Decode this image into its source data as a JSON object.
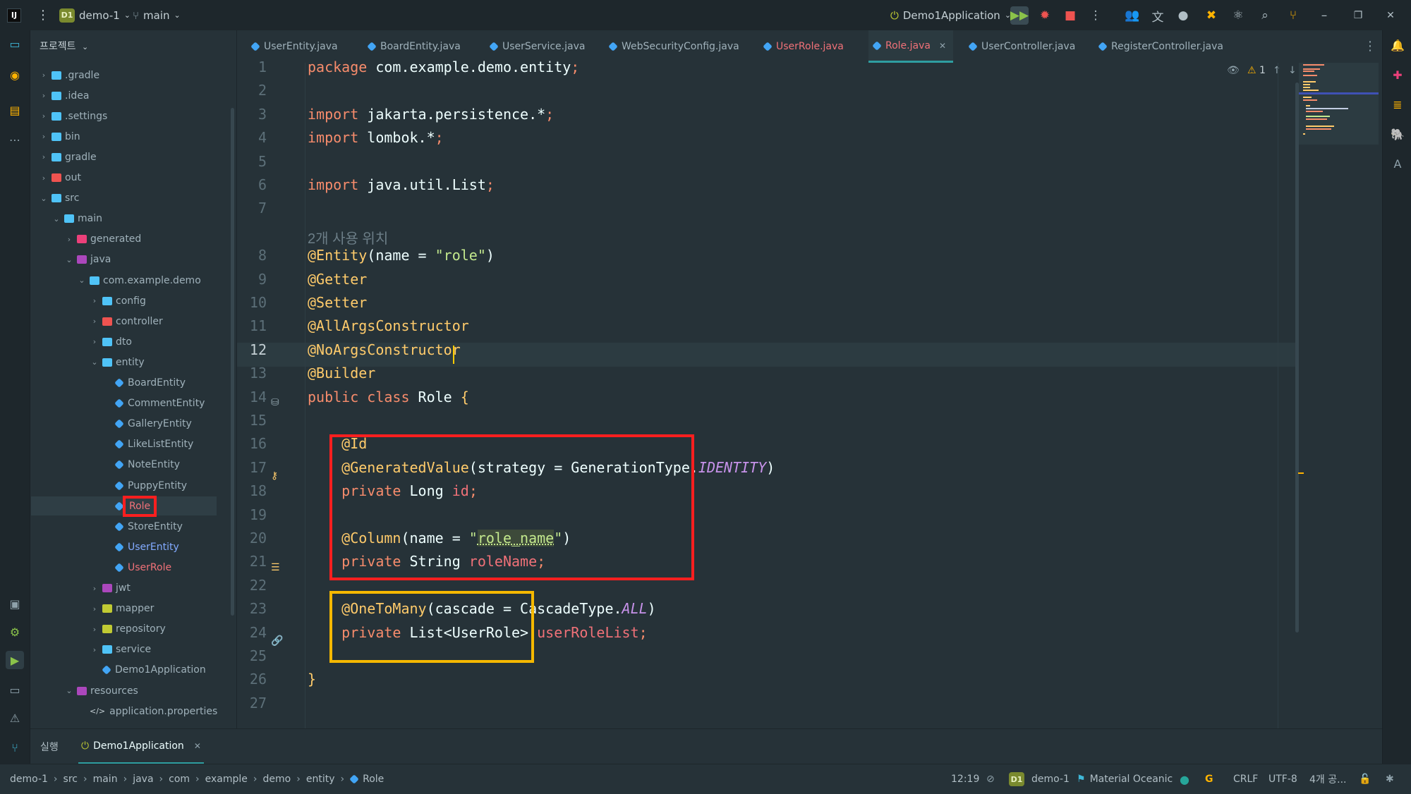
{
  "titlebar": {
    "project_badge": "D1",
    "project_name": "demo-1",
    "branch": "main",
    "run_config": "Demo1Application",
    "window_min": "–",
    "window_max": "❐",
    "window_close": "✕"
  },
  "project_panel": {
    "title": "프로젝트",
    "tree": [
      {
        "label": ".gradle",
        "depth": 0,
        "expanded": false,
        "kind": "folder",
        "color": "#4fc3f7"
      },
      {
        "label": ".idea",
        "depth": 0,
        "expanded": false,
        "kind": "folder",
        "color": "#4fc3f7"
      },
      {
        "label": ".settings",
        "depth": 0,
        "expanded": false,
        "kind": "folder",
        "color": "#4fc3f7"
      },
      {
        "label": "bin",
        "depth": 0,
        "expanded": false,
        "kind": "folder",
        "color": "#4fc3f7"
      },
      {
        "label": "gradle",
        "depth": 0,
        "expanded": false,
        "kind": "folder",
        "color": "#4fc3f7"
      },
      {
        "label": "out",
        "depth": 0,
        "expanded": false,
        "kind": "folder",
        "color": "#ef5350"
      },
      {
        "label": "src",
        "depth": 0,
        "expanded": true,
        "kind": "folder",
        "color": "#4fc3f7"
      },
      {
        "label": "main",
        "depth": 1,
        "expanded": true,
        "kind": "folder",
        "color": "#4fc3f7"
      },
      {
        "label": "generated",
        "depth": 2,
        "expanded": false,
        "kind": "folder",
        "color": "#ec407a"
      },
      {
        "label": "java",
        "depth": 2,
        "expanded": true,
        "kind": "folder",
        "color": "#ab47bc"
      },
      {
        "label": "com.example.demo",
        "depth": 3,
        "expanded": true,
        "kind": "folder",
        "color": "#4fc3f7"
      },
      {
        "label": "config",
        "depth": 4,
        "expanded": false,
        "kind": "folder",
        "color": "#4fc3f7"
      },
      {
        "label": "controller",
        "depth": 4,
        "expanded": false,
        "kind": "folder",
        "color": "#ef5350"
      },
      {
        "label": "dto",
        "depth": 4,
        "expanded": false,
        "kind": "folder",
        "color": "#4fc3f7"
      },
      {
        "label": "entity",
        "depth": 4,
        "expanded": true,
        "kind": "folder",
        "color": "#4fc3f7"
      },
      {
        "label": "BoardEntity",
        "depth": 5,
        "kind": "file",
        "color": "#9fb1ba"
      },
      {
        "label": "CommentEntity",
        "depth": 5,
        "kind": "file",
        "color": "#9fb1ba"
      },
      {
        "label": "GalleryEntity",
        "depth": 5,
        "kind": "file",
        "color": "#9fb1ba"
      },
      {
        "label": "LikeListEntity",
        "depth": 5,
        "kind": "file",
        "color": "#9fb1ba"
      },
      {
        "label": "NoteEntity",
        "depth": 5,
        "kind": "file",
        "color": "#9fb1ba"
      },
      {
        "label": "PuppyEntity",
        "depth": 5,
        "kind": "file",
        "color": "#9fb1ba"
      },
      {
        "label": "Role",
        "depth": 5,
        "kind": "file",
        "color": "#f07178",
        "selected": true
      },
      {
        "label": "StoreEntity",
        "depth": 5,
        "kind": "file",
        "color": "#9fb1ba"
      },
      {
        "label": "UserEntity",
        "depth": 5,
        "kind": "file",
        "color": "#82aaff"
      },
      {
        "label": "UserRole",
        "depth": 5,
        "kind": "file",
        "color": "#f07178"
      },
      {
        "label": "jwt",
        "depth": 4,
        "expanded": false,
        "kind": "folder",
        "color": "#ab47bc"
      },
      {
        "label": "mapper",
        "depth": 4,
        "expanded": false,
        "kind": "folder",
        "color": "#c0ca33"
      },
      {
        "label": "repository",
        "depth": 4,
        "expanded": false,
        "kind": "folder",
        "color": "#c0ca33"
      },
      {
        "label": "service",
        "depth": 4,
        "expanded": false,
        "kind": "folder",
        "color": "#4fc3f7"
      },
      {
        "label": "Demo1Application",
        "depth": 4,
        "kind": "app",
        "color": "#9fb1ba"
      },
      {
        "label": "resources",
        "depth": 2,
        "expanded": true,
        "kind": "folder",
        "color": "#ab47bc"
      },
      {
        "label": "application.properties",
        "depth": 3,
        "kind": "props",
        "color": "#9fb1ba"
      }
    ]
  },
  "tabs": [
    {
      "label": "UserEntity.java",
      "color": "#9fb1ba",
      "active": false
    },
    {
      "label": "BoardEntity.java",
      "color": "#9fb1ba",
      "active": false
    },
    {
      "label": "UserService.java",
      "color": "#9fb1ba",
      "active": false
    },
    {
      "label": "WebSecurityConfig.java",
      "color": "#9fb1ba",
      "active": false
    },
    {
      "label": "UserRole.java",
      "color": "#f07178",
      "active": false
    },
    {
      "label": "Role.java",
      "color": "#f07178",
      "active": true
    },
    {
      "label": "UserController.java",
      "color": "#9fb1ba",
      "active": false
    },
    {
      "label": "RegisterController.java",
      "color": "#9fb1ba",
      "active": false
    }
  ],
  "editor": {
    "warning_count": "1",
    "usage_hint": "2개 사용 위치",
    "line_numbers": [
      "1",
      "2",
      "3",
      "4",
      "5",
      "6",
      "7",
      "8",
      "9",
      "10",
      "11",
      "12",
      "13",
      "14",
      "15",
      "16",
      "17",
      "18",
      "19",
      "20",
      "21",
      "22",
      "23",
      "24",
      "25",
      "26",
      "27"
    ],
    "current_line": "12",
    "lines": [
      [
        [
          "kw2",
          "package "
        ],
        [
          "txt",
          "com.example.demo.entity"
        ],
        [
          "kw2",
          ";"
        ]
      ],
      [],
      [
        [
          "kw2",
          "import "
        ],
        [
          "txt",
          "jakarta.persistence.*"
        ],
        [
          "kw2",
          ";"
        ]
      ],
      [
        [
          "kw2",
          "import "
        ],
        [
          "txt",
          "lombok.*"
        ],
        [
          "kw2",
          ";"
        ]
      ],
      [],
      [
        [
          "kw2",
          "import "
        ],
        [
          "txt",
          "java.util.List"
        ],
        [
          "kw2",
          ";"
        ]
      ],
      [],
      [
        [
          "ann",
          "@Entity"
        ],
        [
          "txt",
          "(name = "
        ],
        [
          "str",
          "\"role\""
        ],
        [
          "txt",
          ")"
        ]
      ],
      [
        [
          "ann",
          "@Getter"
        ]
      ],
      [
        [
          "ann",
          "@Setter"
        ]
      ],
      [
        [
          "ann",
          "@AllArgsConstructor"
        ]
      ],
      [
        [
          "ann",
          "@NoArgsConstructor"
        ]
      ],
      [
        [
          "ann",
          "@Builder"
        ]
      ],
      [
        [
          "kw2",
          "public class "
        ],
        [
          "txt",
          "Role "
        ],
        [
          "ann",
          "{"
        ]
      ],
      [],
      [
        [
          "txt",
          "    "
        ],
        [
          "ann",
          "@Id"
        ]
      ],
      [
        [
          "txt",
          "    "
        ],
        [
          "ann",
          "@GeneratedValue"
        ],
        [
          "txt",
          "(strategy = GenerationType."
        ],
        [
          "itl",
          "IDENTITY"
        ],
        [
          "txt",
          ")"
        ]
      ],
      [
        [
          "txt",
          "    "
        ],
        [
          "kw2",
          "private "
        ],
        [
          "txt",
          "Long "
        ],
        [
          "fld",
          "id"
        ],
        [
          "kw2",
          ";"
        ]
      ],
      [],
      [
        [
          "txt",
          "    "
        ],
        [
          "ann",
          "@Column"
        ],
        [
          "txt",
          "(name = "
        ],
        [
          "str",
          "\""
        ],
        [
          "str",
          "role_name"
        ],
        [
          "str",
          "\""
        ],
        [
          "txt",
          ")"
        ]
      ],
      [
        [
          "txt",
          "    "
        ],
        [
          "kw2",
          "private "
        ],
        [
          "txt",
          "String "
        ],
        [
          "fld",
          "roleName"
        ],
        [
          "kw2",
          ";"
        ]
      ],
      [],
      [
        [
          "txt",
          "    "
        ],
        [
          "ann",
          "@OneToMany"
        ],
        [
          "txt",
          "(cascade = CascadeType."
        ],
        [
          "itl",
          "ALL"
        ],
        [
          "txt",
          ")"
        ]
      ],
      [
        [
          "txt",
          "    "
        ],
        [
          "kw2",
          "private "
        ],
        [
          "txt",
          "List<UserRole> "
        ],
        [
          "fld",
          "userRoleList"
        ],
        [
          "kw2",
          ";"
        ]
      ],
      [],
      [
        [
          "ann",
          "}"
        ]
      ],
      []
    ]
  },
  "run_panel": {
    "tab_run": "실행",
    "tab_app": "Demo1Application"
  },
  "statusbar": {
    "breadcrumb": [
      "demo-1",
      "src",
      "main",
      "java",
      "com",
      "example",
      "demo",
      "entity",
      "Role"
    ],
    "position": "12:19",
    "project_badge": "D1",
    "project": "demo-1",
    "theme": "Material Oceanic",
    "line_ending": "CRLF",
    "encoding": "UTF-8",
    "indent": "4개 공..."
  },
  "colors": {
    "accent_red": "#ff1f1f",
    "accent_yellow": "#f5b800",
    "teal": "#2f9ea1"
  }
}
